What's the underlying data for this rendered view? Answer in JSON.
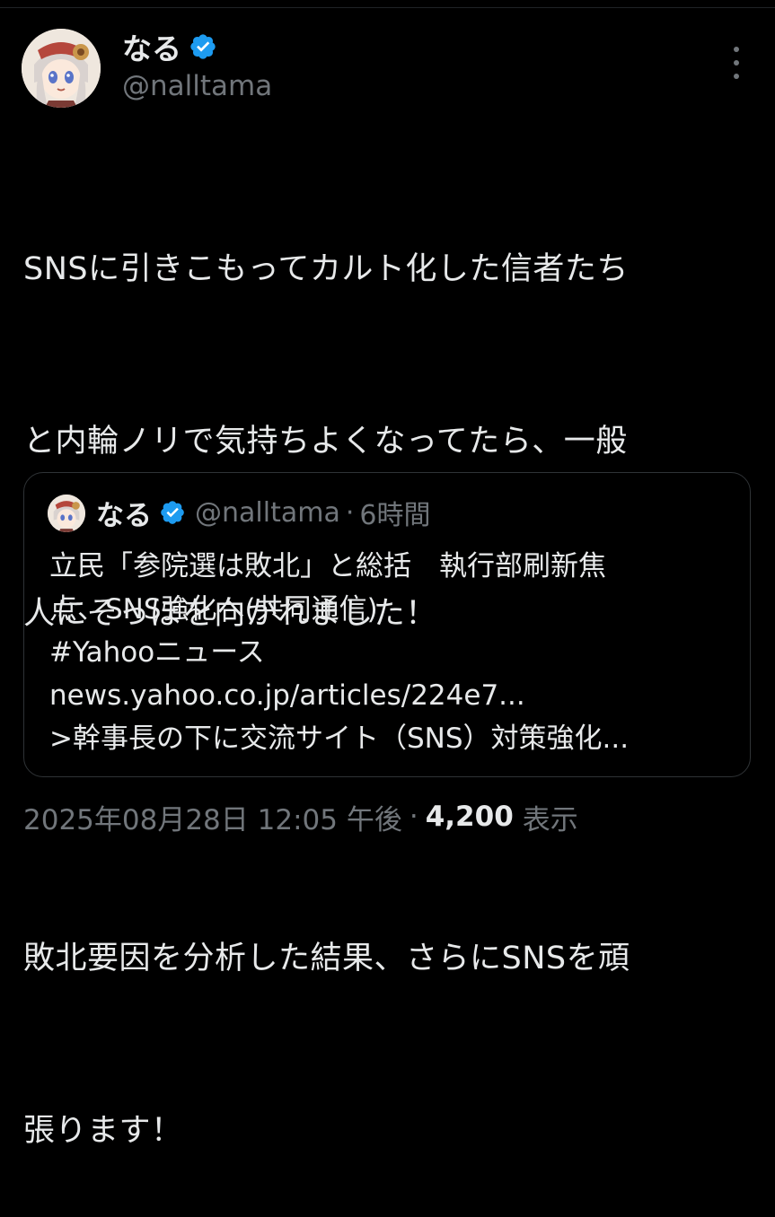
{
  "author": {
    "display_name": "なる",
    "handle": "@nalltama",
    "verified_color": "#1d9bf0",
    "avatar_icon": "anime-avatar-icon"
  },
  "tweet": {
    "lines": [
      "SNSに引きこもってカルト化した信者たち",
      "と内輪ノリで気持ちよくなってたら、一般",
      "人にそっぽを向かれました！",
      "",
      "敗北要因を分析した結果、さらにSNSを頑",
      "張ります！"
    ]
  },
  "quote": {
    "display_name": "なる",
    "handle": "@nalltama",
    "separator": "·",
    "time": "6時間",
    "lines": [
      "立民「参院選は敗北」と総括　執行部刷新焦",
      "点、SNS強化へ(共同通信)",
      "#Yahooニュース",
      "news.yahoo.co.jp/articles/224e7...",
      ">幹事長の下に交流サイト（SNS）対策強化..."
    ]
  },
  "meta": {
    "timestamp": "2025年08月28日 12:05 午後",
    "separator": "·",
    "views_count": "4,200",
    "views_label": "表示"
  },
  "colors": {
    "background": "#000000",
    "text_primary": "#e7e9ea",
    "text_secondary": "#71767b",
    "border": "#2f3336",
    "verified": "#1d9bf0"
  }
}
